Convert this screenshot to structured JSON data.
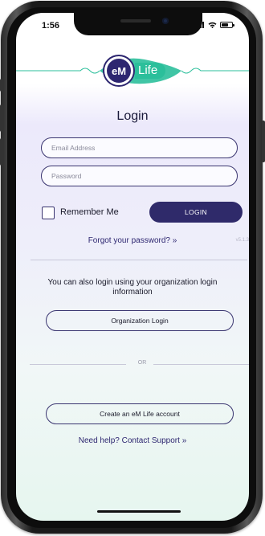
{
  "status_bar": {
    "time": "1:56"
  },
  "brand": {
    "logo_mark": "eM",
    "logo_word": "Life",
    "primary_color": "#2d2670",
    "accent_color": "#2bbf9b"
  },
  "login_form": {
    "title": "Login",
    "email_placeholder": "Email Address",
    "email_value": "",
    "password_placeholder": "Password",
    "password_value": "",
    "remember_me_label": "Remember Me",
    "remember_me_checked": false,
    "login_button_label": "LOGIN",
    "forgot_password_link": "Forgot your password? »",
    "version": "v5.1.3"
  },
  "organization": {
    "info_text": "You can also login using your organization login information",
    "button_label": "Organization Login"
  },
  "separator": {
    "label": "OR"
  },
  "signup": {
    "create_account_label": "Create an eM Life account",
    "help_link": "Need help? Contact Support »"
  }
}
